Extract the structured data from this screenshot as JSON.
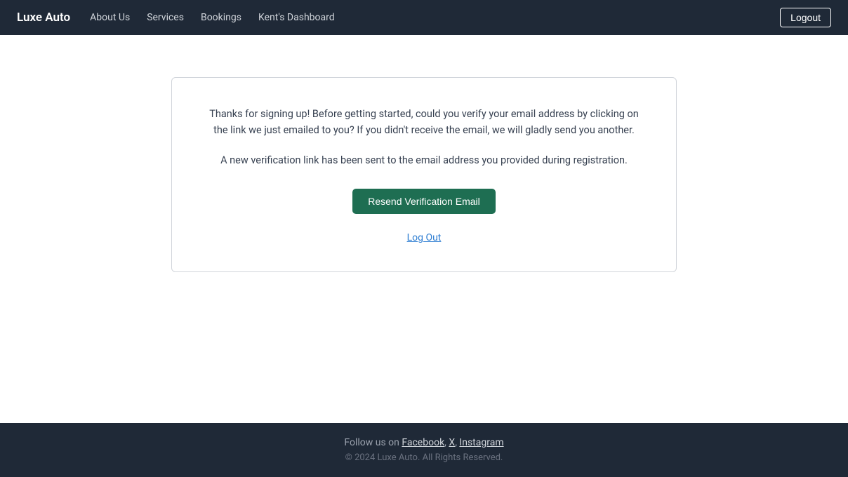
{
  "navbar": {
    "brand": "Luxe Auto",
    "links": [
      {
        "label": "About Us",
        "id": "about-us"
      },
      {
        "label": "Services",
        "id": "services"
      },
      {
        "label": "Bookings",
        "id": "bookings"
      },
      {
        "label": "Kent's Dashboard",
        "id": "kents-dashboard"
      }
    ],
    "logout_label": "Logout"
  },
  "card": {
    "message": "Thanks for signing up! Before getting started, could you verify your email address by clicking on the link we just emailed to you? If you didn't receive the email, we will gladly send you another.",
    "sent_message": "A new verification link has been sent to the email address you provided during registration.",
    "resend_button": "Resend Verification Email",
    "logout_link": "Log Out"
  },
  "footer": {
    "follow_text": "Follow us on ",
    "links": [
      {
        "label": "Facebook",
        "id": "facebook"
      },
      {
        "label": "X",
        "id": "x"
      },
      {
        "label": "Instagram",
        "id": "instagram"
      }
    ],
    "copyright": "© 2024 Luxe Auto. All Rights Reserved."
  }
}
